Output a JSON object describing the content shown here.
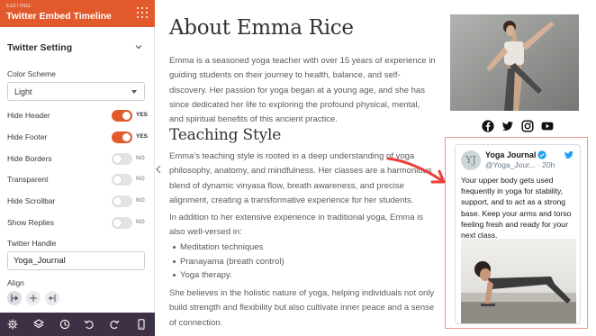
{
  "sidebar": {
    "editing_label": "EDITING:",
    "title": "Twitter Embed Timeline",
    "section_title": "Twitter Setting",
    "color_scheme": {
      "label": "Color Scheme",
      "value": "Light"
    },
    "toggles": [
      {
        "label": "Hide Header",
        "state": "YES",
        "on": true
      },
      {
        "label": "Hide Footer",
        "state": "YES",
        "on": true
      },
      {
        "label": "Hide Borders",
        "state": "NO",
        "on": false
      },
      {
        "label": "Transparent",
        "state": "NO",
        "on": false
      },
      {
        "label": "Hide Scrollbar",
        "state": "NO",
        "on": false
      },
      {
        "label": "Show Replies",
        "state": "NO",
        "on": false
      }
    ],
    "handle": {
      "label": "Twitter Handle",
      "value": "Yoga_Journal"
    },
    "align": {
      "label": "Align",
      "options": [
        "left",
        "center",
        "right"
      ],
      "selected": "left"
    },
    "footer_icons": [
      "gear-icon",
      "layers-icon",
      "history-icon",
      "undo-icon",
      "redo-icon",
      "mobile-icon"
    ],
    "accent_color": "#e25a2c",
    "footer_color": "#3e3145"
  },
  "article": {
    "title": "About Emma Rice",
    "intro": "Emma is a seasoned yoga teacher with over 15 years of experience in guiding students on their journey to health, balance, and self-discovery. Her passion for yoga began at a young age, and she has since dedicated her life to exploring the profound physical, mental, and spiritual benefits of this ancient practice.",
    "section_title": "Teaching Style",
    "teaching": "Emma's teaching style is rooted in a deep understanding of yoga philosophy, anatomy, and mindfulness. Her classes are a harmonious blend of dynamic vinyasa flow, breath awareness, and precise alignment, creating a transformative experience for her students.",
    "additional": "In addition to her extensive experience in traditional yoga, Emma is also well-versed in:",
    "bullets": [
      "Meditation techniques",
      "Pranayama (breath control)",
      "Yoga therapy."
    ],
    "closing": "She believes in the holistic nature of yoga, helping individuals not only build strength and flexibility but also cultivate inner peace and a sense of connection."
  },
  "social_icons": [
    "facebook-icon",
    "twitter-icon",
    "instagram-icon",
    "youtube-icon"
  ],
  "tweet": {
    "avatar_text": "YJ",
    "name": "Yoga Journal",
    "handle_time": "@Yoga_Jour... · 20h",
    "text": "Your upper body gets used frequently in yoga for stability, support, and to act as a strong base. Keep your arms and torso feeling fresh and ready for your next class.",
    "verified_color": "#1da1f2",
    "frame_color": "#f0968f"
  },
  "annotation_arrow_color": "#e8403a"
}
